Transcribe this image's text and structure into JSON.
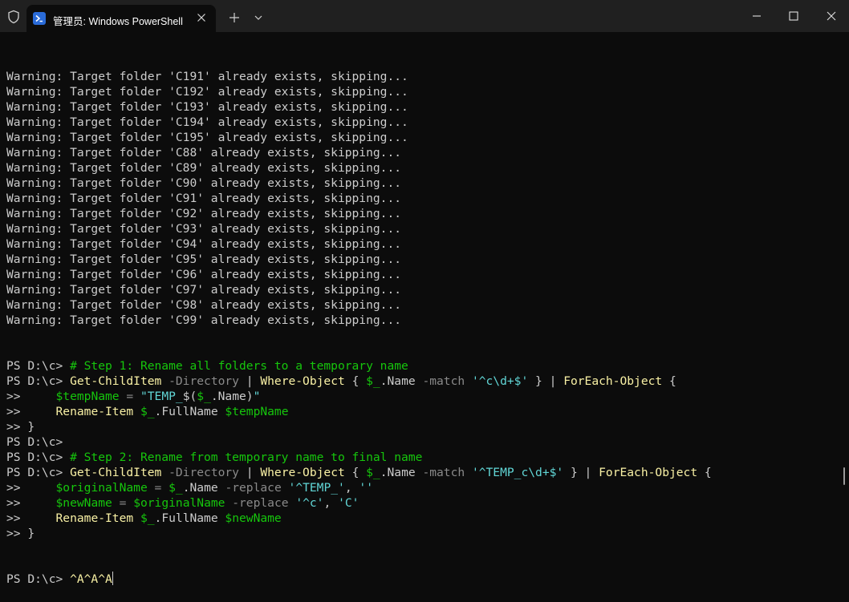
{
  "window": {
    "tab_title": "管理员: Windows PowerShell"
  },
  "colors": {
    "background": "#0c0c0c",
    "titlebar": "#202020",
    "text": "#cccccc",
    "command": "#f9f1a5",
    "parameter": "#8a8a8a",
    "string": "#61d6d6",
    "variable_comment": "#16c60c"
  },
  "icons": [
    "shield-icon",
    "powershell-icon",
    "close-tab-icon",
    "plus-icon",
    "chevron-down-icon",
    "minimize-icon",
    "maximize-icon",
    "close-window-icon"
  ],
  "terminal": {
    "warnings": [
      "Warning: Target folder 'C191' already exists, skipping...",
      "Warning: Target folder 'C192' already exists, skipping...",
      "Warning: Target folder 'C193' already exists, skipping...",
      "Warning: Target folder 'C194' already exists, skipping...",
      "Warning: Target folder 'C195' already exists, skipping...",
      "Warning: Target folder 'C88' already exists, skipping...",
      "Warning: Target folder 'C89' already exists, skipping...",
      "Warning: Target folder 'C90' already exists, skipping...",
      "Warning: Target folder 'C91' already exists, skipping...",
      "Warning: Target folder 'C92' already exists, skipping...",
      "Warning: Target folder 'C93' already exists, skipping...",
      "Warning: Target folder 'C94' already exists, skipping...",
      "Warning: Target folder 'C95' already exists, skipping...",
      "Warning: Target folder 'C96' already exists, skipping...",
      "Warning: Target folder 'C97' already exists, skipping...",
      "Warning: Target folder 'C98' already exists, skipping...",
      "Warning: Target folder 'C99' already exists, skipping..."
    ],
    "code_lines": [
      [
        {
          "t": "PS D:\\c> ",
          "c": ""
        },
        {
          "t": "# Step 1: Rename all folders to a temporary name",
          "c": "v"
        }
      ],
      [
        {
          "t": "PS D:\\c> ",
          "c": ""
        },
        {
          "t": "Get-ChildItem",
          "c": "y"
        },
        {
          "t": " ",
          "c": ""
        },
        {
          "t": "-Directory",
          "c": "g"
        },
        {
          "t": " | ",
          "c": ""
        },
        {
          "t": "Where-Object",
          "c": "y"
        },
        {
          "t": " { ",
          "c": ""
        },
        {
          "t": "$_",
          "c": "v"
        },
        {
          "t": ".Name ",
          "c": ""
        },
        {
          "t": "-match",
          "c": "g"
        },
        {
          "t": " ",
          "c": ""
        },
        {
          "t": "'^c\\d+$'",
          "c": "b"
        },
        {
          "t": " } | ",
          "c": ""
        },
        {
          "t": "ForEach-Object",
          "c": "y"
        },
        {
          "t": " {",
          "c": ""
        }
      ],
      [
        {
          "t": ">>     ",
          "c": ""
        },
        {
          "t": "$tempName",
          "c": "v"
        },
        {
          "t": " ",
          "c": ""
        },
        {
          "t": "=",
          "c": "g"
        },
        {
          "t": " ",
          "c": ""
        },
        {
          "t": "\"TEMP_",
          "c": "b"
        },
        {
          "t": "$(",
          "c": ""
        },
        {
          "t": "$_",
          "c": "v"
        },
        {
          "t": ".Name)",
          "c": ""
        },
        {
          "t": "\"",
          "c": "b"
        }
      ],
      [
        {
          "t": ">>     ",
          "c": ""
        },
        {
          "t": "Rename-Item",
          "c": "y"
        },
        {
          "t": " ",
          "c": ""
        },
        {
          "t": "$_",
          "c": "v"
        },
        {
          "t": ".FullName ",
          "c": ""
        },
        {
          "t": "$tempName",
          "c": "v"
        }
      ],
      [
        {
          "t": ">> }",
          "c": ""
        }
      ],
      [
        {
          "t": "PS D:\\c>",
          "c": ""
        }
      ],
      [
        {
          "t": "PS D:\\c> ",
          "c": ""
        },
        {
          "t": "# Step 2: Rename from temporary name to final name",
          "c": "v"
        }
      ],
      [
        {
          "t": "PS D:\\c> ",
          "c": ""
        },
        {
          "t": "Get-ChildItem",
          "c": "y"
        },
        {
          "t": " ",
          "c": ""
        },
        {
          "t": "-Directory",
          "c": "g"
        },
        {
          "t": " | ",
          "c": ""
        },
        {
          "t": "Where-Object",
          "c": "y"
        },
        {
          "t": " { ",
          "c": ""
        },
        {
          "t": "$_",
          "c": "v"
        },
        {
          "t": ".Name ",
          "c": ""
        },
        {
          "t": "-match",
          "c": "g"
        },
        {
          "t": " ",
          "c": ""
        },
        {
          "t": "'^TEMP_c\\d+$'",
          "c": "b"
        },
        {
          "t": " } | ",
          "c": ""
        },
        {
          "t": "ForEach-Object",
          "c": "y"
        },
        {
          "t": " {",
          "c": ""
        }
      ],
      [
        {
          "t": ">>     ",
          "c": ""
        },
        {
          "t": "$originalName",
          "c": "v"
        },
        {
          "t": " ",
          "c": ""
        },
        {
          "t": "=",
          "c": "g"
        },
        {
          "t": " ",
          "c": ""
        },
        {
          "t": "$_",
          "c": "v"
        },
        {
          "t": ".Name ",
          "c": ""
        },
        {
          "t": "-replace",
          "c": "g"
        },
        {
          "t": " ",
          "c": ""
        },
        {
          "t": "'^TEMP_'",
          "c": "b"
        },
        {
          "t": ", ",
          "c": ""
        },
        {
          "t": "''",
          "c": "b"
        }
      ],
      [
        {
          "t": ">>     ",
          "c": ""
        },
        {
          "t": "$newName",
          "c": "v"
        },
        {
          "t": " ",
          "c": ""
        },
        {
          "t": "=",
          "c": "g"
        },
        {
          "t": " ",
          "c": ""
        },
        {
          "t": "$originalName",
          "c": "v"
        },
        {
          "t": " ",
          "c": ""
        },
        {
          "t": "-replace",
          "c": "g"
        },
        {
          "t": " ",
          "c": ""
        },
        {
          "t": "'^c'",
          "c": "b"
        },
        {
          "t": ", ",
          "c": ""
        },
        {
          "t": "'C'",
          "c": "b"
        }
      ],
      [
        {
          "t": ">>     ",
          "c": ""
        },
        {
          "t": "Rename-Item",
          "c": "y"
        },
        {
          "t": " ",
          "c": ""
        },
        {
          "t": "$_",
          "c": "v"
        },
        {
          "t": ".FullName ",
          "c": ""
        },
        {
          "t": "$newName",
          "c": "v"
        }
      ],
      [
        {
          "t": ">> }",
          "c": ""
        }
      ]
    ],
    "prompt": "PS D:\\c> ",
    "current_input": "^A^A^A"
  }
}
